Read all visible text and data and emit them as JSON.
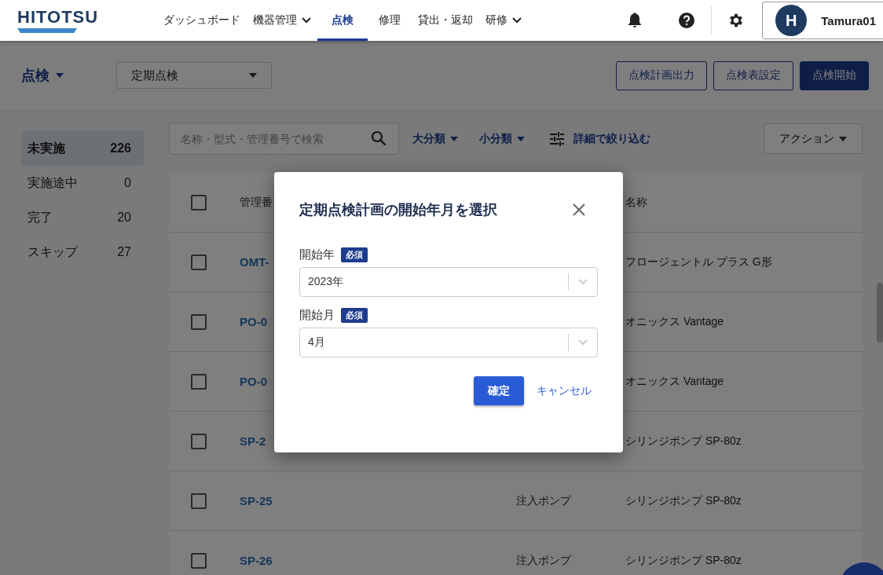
{
  "header": {
    "logo": "HITOTSU",
    "nav": [
      {
        "label": "ダッシュボード",
        "has_menu": false,
        "selected": false
      },
      {
        "label": "機器管理",
        "has_menu": true,
        "selected": false
      },
      {
        "label": "点検",
        "has_menu": false,
        "selected": true
      },
      {
        "label": "修理",
        "has_menu": false,
        "selected": false
      },
      {
        "label": "貸出・返却",
        "has_menu": false,
        "selected": false
      },
      {
        "label": "研修",
        "has_menu": true,
        "selected": false
      }
    ],
    "avatar_letter": "H",
    "user": "Tamura01"
  },
  "subheader": {
    "title": "点検",
    "type_select": "定期点検",
    "buttons": [
      {
        "label": "点検計画出力",
        "kind": "outline"
      },
      {
        "label": "点検表設定",
        "kind": "outline"
      },
      {
        "label": "点検開始",
        "kind": "primary"
      }
    ]
  },
  "sidebar": [
    {
      "label": "未実施",
      "count": "226",
      "selected": true
    },
    {
      "label": "実施途中",
      "count": "0",
      "selected": false
    },
    {
      "label": "完了",
      "count": "20",
      "selected": false
    },
    {
      "label": "スキップ",
      "count": "27",
      "selected": false
    }
  ],
  "toolbar": {
    "search": {
      "placeholder": "名称・型式・管理番号で検索"
    },
    "filters": [
      {
        "label": "大分類",
        "kind": "dropdown"
      },
      {
        "label": "小分類",
        "kind": "dropdown"
      },
      {
        "label": "詳細で絞り込む",
        "kind": "detail"
      }
    ],
    "action": "アクション"
  },
  "table": {
    "header": {
      "checked": false,
      "id": "管理番",
      "name": "名称"
    },
    "rows": [
      {
        "checked": false,
        "id": "OMT-",
        "name": "フロージェントル プラス G形"
      },
      {
        "checked": false,
        "id": "PO-0",
        "name": "オニックス Vantage"
      },
      {
        "checked": false,
        "id": "PO-0",
        "name": "オニックス Vantage"
      },
      {
        "checked": false,
        "id": "SP-2",
        "name": "シリンジポンプ SP-80z"
      },
      {
        "checked": false,
        "id": "SP-25",
        "category": "注入ポンプ",
        "name": "シリンジポンプ SP-80z"
      },
      {
        "checked": false,
        "id": "SP-26",
        "category": "注入ポンプ",
        "name": "シリンジポンプ SP-80z"
      }
    ]
  },
  "modal": {
    "title": "定期点検計画の開始年月を選択",
    "fields": [
      {
        "label": "開始年",
        "badge": "必須",
        "value": "2023年"
      },
      {
        "label": "開始月",
        "badge": "必須",
        "value": "4月"
      }
    ],
    "confirm": "確定",
    "cancel": "キャンセル"
  }
}
